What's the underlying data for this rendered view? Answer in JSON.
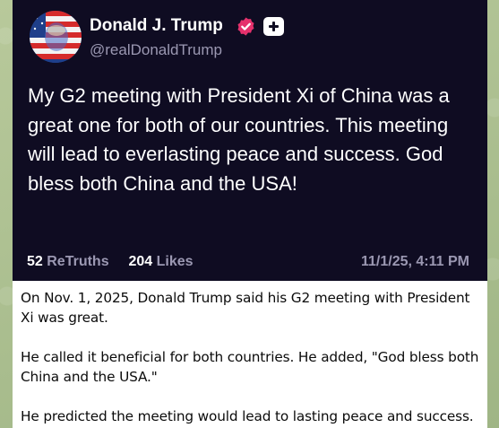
{
  "post": {
    "display_name": "Donald J. Trump",
    "handle": "@realDonaldTrump",
    "verified_icon": "verified-badge-icon",
    "plus_icon": "plus-icon",
    "avatar_icon": "avatar-flag-portrait",
    "text": "My G2 meeting with President Xi of China was a great one for both of our countries. This meeting will lead to everlasting peace and success. God bless both China and the USA!",
    "retruths_count": "52",
    "retruths_label": "ReTruths",
    "likes_count": "204",
    "likes_label": "Likes",
    "timestamp": "11/1/25, 4:11 PM"
  },
  "caption": {
    "paragraph_1": "On Nov. 1, 2025, Donald Trump said his G2 meeting with President Xi was great.",
    "paragraph_2": "He called it beneficial for both countries. He added, \"God bless both China and the USA.\"",
    "paragraph_3": "He predicted the meeting would lead to lasting peace and success."
  },
  "colors": {
    "card_background": "#0f0c22",
    "muted_text": "#9b98b2",
    "verified_badge": "#e5316c",
    "chat_background": "#a9bd8f"
  }
}
